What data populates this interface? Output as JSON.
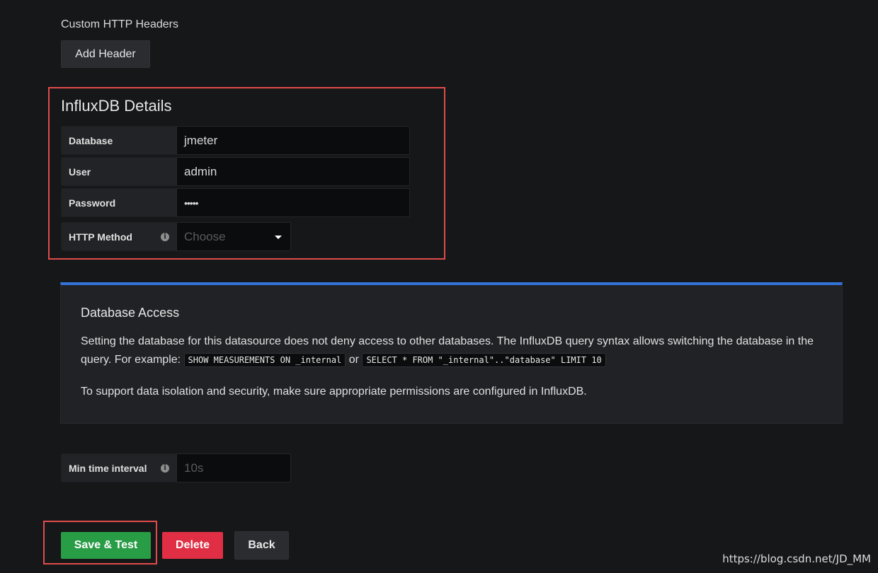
{
  "custom_headers": {
    "label": "Custom HTTP Headers",
    "add_button": "Add Header"
  },
  "influx": {
    "title": "InfluxDB Details",
    "fields": {
      "database": {
        "label": "Database",
        "value": "jmeter"
      },
      "user": {
        "label": "User",
        "value": "admin"
      },
      "password": {
        "label": "Password",
        "value": "•••••"
      },
      "http_method": {
        "label": "HTTP Method",
        "placeholder": "Choose"
      }
    }
  },
  "access": {
    "title": "Database Access",
    "text_before": "Setting the database for this datasource does not deny access to other databases. The InfluxDB query syntax allows switching the database in the query. For example:",
    "code1": "SHOW MEASUREMENTS ON _internal",
    "or": "or",
    "code2": "SELECT * FROM \"_internal\"..\"database\" LIMIT 10",
    "text_after": "To support data isolation and security, make sure appropriate permissions are configured in InfluxDB."
  },
  "min_interval": {
    "label": "Min time interval",
    "placeholder": "10s"
  },
  "actions": {
    "save": "Save & Test",
    "delete": "Delete",
    "back": "Back"
  },
  "watermark": "https://blog.csdn.net/JD_MM",
  "colors": {
    "background": "#161719",
    "highlight": "#e04b4b",
    "accent_blue": "#3274d9",
    "save_green": "#299c46",
    "delete_red": "#e02f44"
  },
  "icons": {
    "info": "info-icon",
    "dropdown": "caret-down-icon"
  }
}
